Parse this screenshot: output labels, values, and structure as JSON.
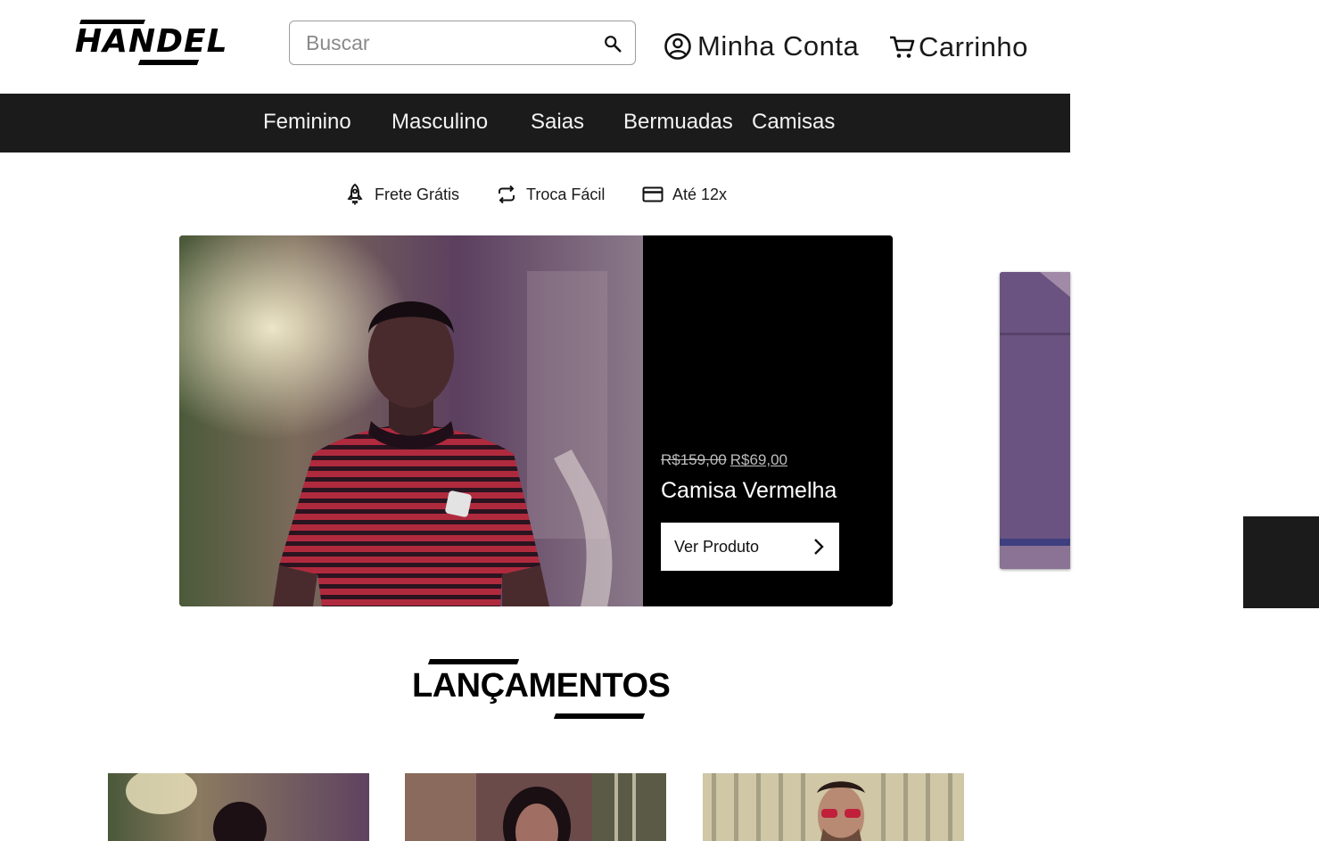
{
  "header": {
    "logo": "HANDEL",
    "search_placeholder": "Buscar",
    "account_label": "Minha Conta",
    "cart_label": "Carrinho"
  },
  "nav": {
    "items": [
      "Feminino",
      "Masculino",
      "Saias",
      "Bermuadas",
      "Camisas"
    ]
  },
  "benefits": [
    {
      "icon": "rocket-icon",
      "label": "Frete Grátis"
    },
    {
      "icon": "exchange-icon",
      "label": "Troca Fácil"
    },
    {
      "icon": "credit-card-icon",
      "label": "Até 12x"
    }
  ],
  "hero": {
    "old_price": "R$159,00",
    "new_price": "R$69,00",
    "product_name": "Camisa Vermelha",
    "button_label": "Ver Produto"
  },
  "section": {
    "title": "LANÇAMENTOS"
  },
  "colors": {
    "nav_bg": "#1b1b1b",
    "hero_info_bg": "#000000",
    "photo_tint": "#5a3a6e"
  }
}
